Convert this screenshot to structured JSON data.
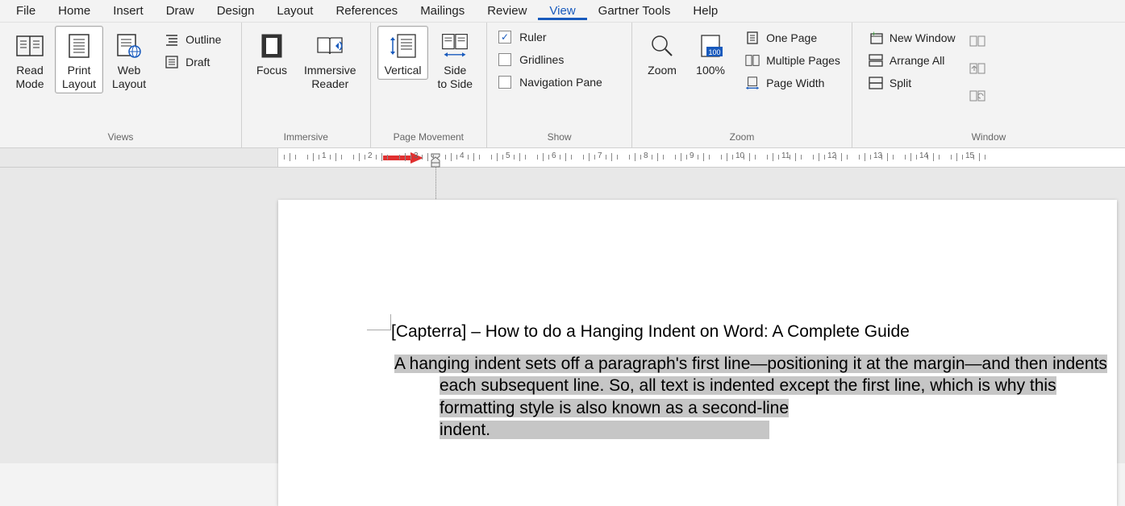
{
  "menu": {
    "items": [
      "File",
      "Home",
      "Insert",
      "Draw",
      "Design",
      "Layout",
      "References",
      "Mailings",
      "Review",
      "View",
      "Gartner Tools",
      "Help"
    ],
    "active": "View"
  },
  "ribbon": {
    "views": {
      "label": "Views",
      "read_mode": "Read\nMode",
      "print_layout": "Print\nLayout",
      "web_layout": "Web\nLayout",
      "outline": "Outline",
      "draft": "Draft"
    },
    "immersive": {
      "label": "Immersive",
      "focus": "Focus",
      "immersive_reader": "Immersive\nReader"
    },
    "page_movement": {
      "label": "Page Movement",
      "vertical": "Vertical",
      "side_to_side": "Side\nto Side"
    },
    "show": {
      "label": "Show",
      "ruler": "Ruler",
      "gridlines": "Gridlines",
      "nav_pane": "Navigation Pane",
      "ruler_checked": true,
      "gridlines_checked": false,
      "nav_checked": false
    },
    "zoom": {
      "label": "Zoom",
      "zoom": "Zoom",
      "hundred": "100%",
      "one_page": "One Page",
      "multiple_pages": "Multiple Pages",
      "page_width": "Page Width"
    },
    "window": {
      "label": "Window",
      "new_window": "New Window",
      "arrange_all": "Arrange All",
      "split": "Split"
    }
  },
  "ruler": {
    "numbers": [
      "1",
      "2",
      "3",
      "4",
      "5",
      "6",
      "7",
      "8",
      "9",
      "10",
      "11",
      "12",
      "13",
      "14",
      "15"
    ]
  },
  "document": {
    "title": "[Capterra] – How to do a Hanging Indent on Word: A Complete Guide",
    "paragraph": "A hanging indent sets off a paragraph's first line—positioning it at the margin—and then indents each subsequent line. So, all text is indented except the first line, which is why this formatting style is also known as a second-line indent."
  }
}
